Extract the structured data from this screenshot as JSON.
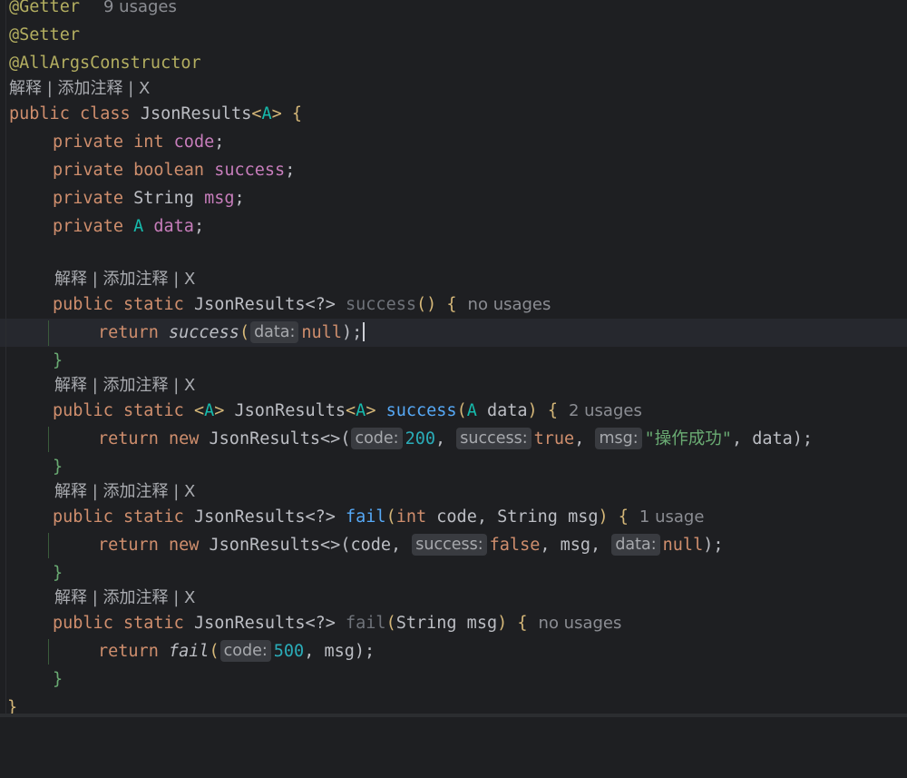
{
  "editor": {
    "annotations": {
      "getter": "@Getter",
      "getter_usages": "9 usages",
      "setter": "@Setter",
      "ctor": "@AllArgsConstructor"
    },
    "lens": {
      "text": "解释 | 添加注释 | X"
    },
    "class_decl": {
      "kw_public": "public",
      "kw_class": "class",
      "name": "JsonResults",
      "lt": "<",
      "type_param": "A",
      "gt": ">",
      "brace": "{"
    },
    "fields": [
      {
        "mod": "private",
        "type": "int",
        "name": "code"
      },
      {
        "mod": "private",
        "type": "boolean",
        "name": "success"
      },
      {
        "mod": "private",
        "type": "String",
        "name": "msg"
      },
      {
        "mod": "private",
        "type": "A",
        "name": "data"
      }
    ],
    "methods": {
      "m1_sig": {
        "mods": "public static",
        "ret": "JsonResults<?>",
        "name": "success",
        "params": "()",
        "brace": "{",
        "usages": "no usages"
      },
      "m1_body": {
        "kw": "return",
        "call": "success",
        "open": "(",
        "hint": "data:",
        "arg": "null",
        "close": ");"
      },
      "m2_sig": {
        "mods": "public static",
        "tparam_open": "<",
        "tparam": "A",
        "tparam_close": ">",
        "ret": "JsonResults",
        "ret_lt": "<",
        "ret_tp": "A",
        "ret_gt": ">",
        "name": "success",
        "p_open": "(",
        "p_type": "A",
        "p_name": " data",
        "p_close": ")",
        "brace": "{",
        "usages": "2 usages"
      },
      "m2_body": {
        "kw": "return new",
        "cls": "JsonResults<>(",
        "h1": "code:",
        "a1": "200",
        "sep1": ",",
        "h2": "success:",
        "a2": "true",
        "sep2": ",",
        "h3": "msg:",
        "a3": "\"操作成功\"",
        "rest": ", data);"
      },
      "m3_sig": {
        "mods": "public static",
        "ret": "JsonResults<?>",
        "name": "fail",
        "p_open": "(",
        "p_kw": "int",
        "p_rest": " code, String msg",
        "p_close": ")",
        "brace": "{",
        "usages": "1 usage"
      },
      "m3_body": {
        "kw": "return new",
        "cls": "JsonResults<>(code,",
        "h1": "success:",
        "a1": "false",
        "mid": ", msg,",
        "h2": "data:",
        "a2": "null",
        "close": ");"
      },
      "m4_sig": {
        "mods": "public static",
        "ret": "JsonResults<?>",
        "name": "fail",
        "p_open": "(",
        "p_rest": "String msg",
        "p_close": ")",
        "brace": "{",
        "usages": "no usages"
      },
      "m4_body": {
        "kw": "return",
        "call": "fail",
        "open": "(",
        "hint": "code:",
        "arg": "500",
        "close": ", msg);"
      }
    },
    "close_brace": "}",
    "class_close": "}"
  },
  "colors": {
    "background": "#1e1f22",
    "keyword": "#cf8e6d",
    "annotation": "#b3ae60",
    "field": "#c77dbb",
    "type_param": "#16baac",
    "method": "#56a8f5",
    "number": "#2aacb8",
    "string": "#6aab73"
  }
}
